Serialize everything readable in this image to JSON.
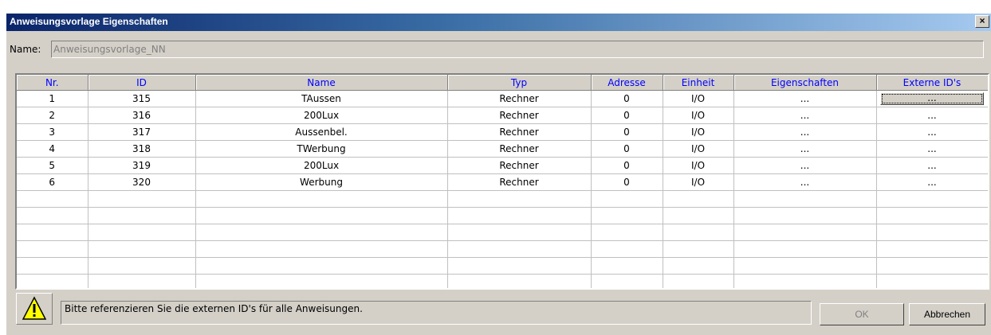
{
  "window": {
    "title": "Anweisungsvorlage Eigenschaften",
    "close_label": "×"
  },
  "name_row": {
    "label": "Name:",
    "value": "Anweisungsvorlage_NN"
  },
  "grid": {
    "columns": [
      "Nr.",
      "ID",
      "Name",
      "Typ",
      "Adresse",
      "Einheit",
      "Eigenschaften",
      "Externe ID's"
    ],
    "rows": [
      [
        "1",
        "315",
        "TAussen",
        "Rechner",
        "0",
        "I/O",
        "...",
        "..."
      ],
      [
        "2",
        "316",
        "200Lux",
        "Rechner",
        "0",
        "I/O",
        "...",
        "..."
      ],
      [
        "3",
        "317",
        "Aussenbel.",
        "Rechner",
        "0",
        "I/O",
        "...",
        "..."
      ],
      [
        "4",
        "318",
        "TWerbung",
        "Rechner",
        "0",
        "I/O",
        "...",
        "..."
      ],
      [
        "5",
        "319",
        "200Lux",
        "Rechner",
        "0",
        "I/O",
        "...",
        "..."
      ],
      [
        "6",
        "320",
        "Werbung",
        "Rechner",
        "0",
        "I/O",
        "...",
        "..."
      ]
    ]
  },
  "status": {
    "icon": "warning-icon",
    "message": "Bitte referenzieren Sie die externen ID's für alle Anweisungen."
  },
  "buttons": {
    "ok": "OK",
    "cancel": "Abbrechen"
  },
  "colors": {
    "titlebar_start": "#0a246a",
    "titlebar_end": "#a6caf0",
    "header_text": "#0000ff",
    "warning_fill": "#ffff00"
  }
}
